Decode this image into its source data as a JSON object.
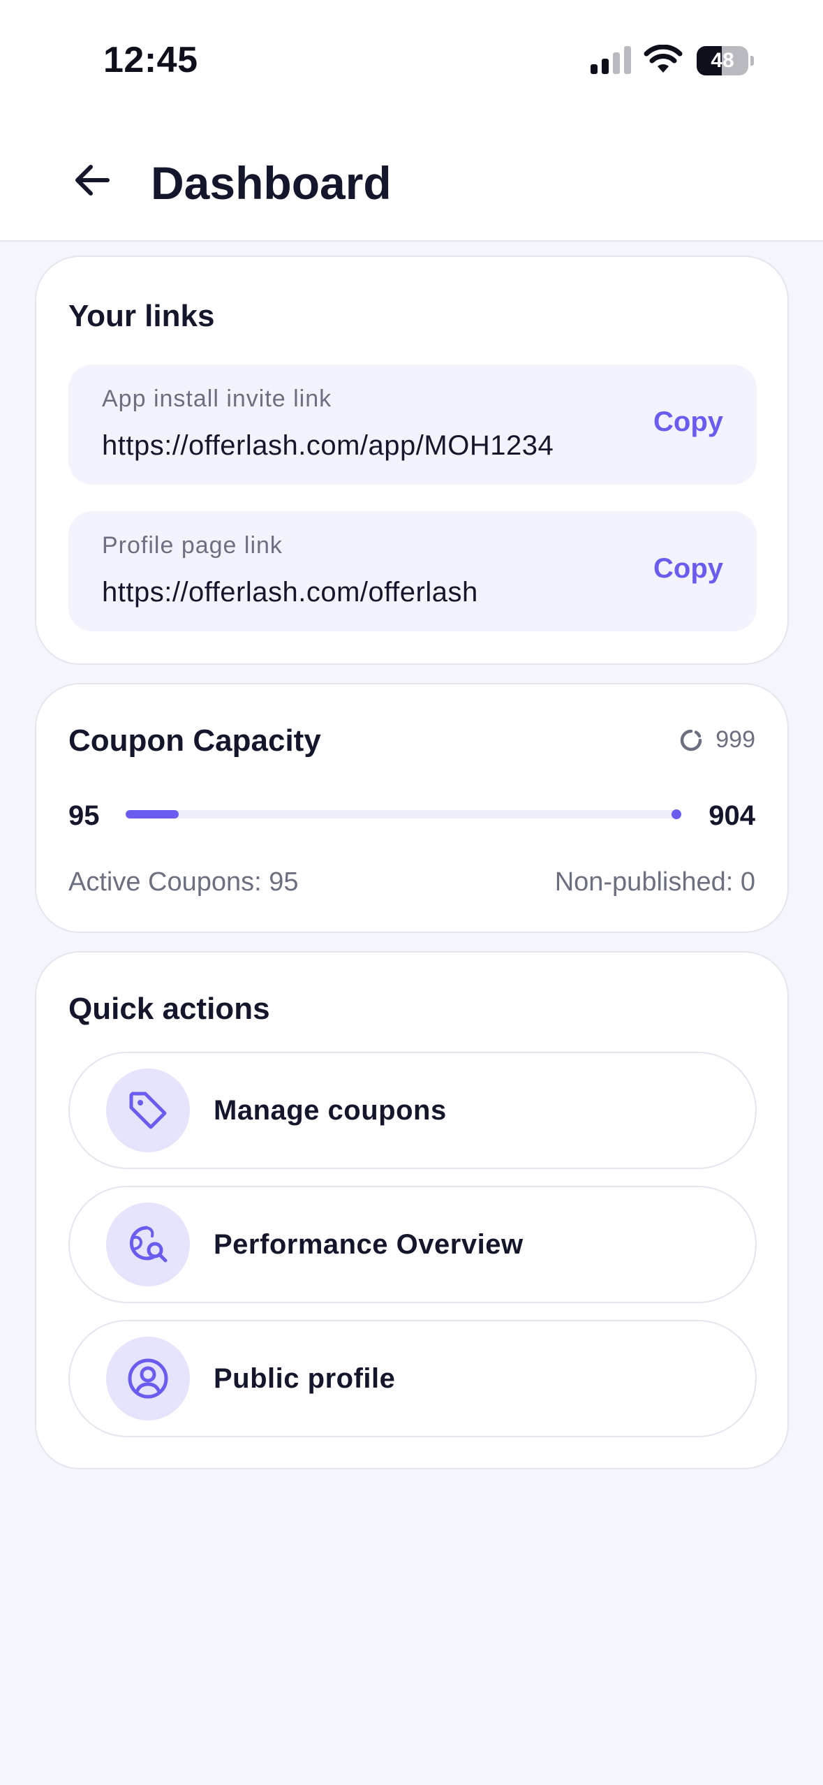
{
  "status_bar": {
    "time": "12:45",
    "battery_level": "48",
    "battery_fraction": 0.48
  },
  "header": {
    "title": "Dashboard",
    "back_icon": "arrow-left-icon"
  },
  "links": {
    "title": "Your links",
    "items": [
      {
        "label": "App install invite link",
        "url": "https://offerlash.com/app/MOH1234",
        "action": "Copy"
      },
      {
        "label": "Profile page link",
        "url": "https://offerlash.com/offerlash",
        "action": "Copy"
      }
    ]
  },
  "capacity": {
    "title": "Coupon Capacity",
    "total": "999",
    "total_icon": "loader-icon",
    "min_label": "95",
    "max_label": "904",
    "used": 95,
    "max": 999,
    "active_text": "Active Coupons: 95",
    "nonpublished_text": "Non-published: 0"
  },
  "quick_actions": {
    "title": "Quick actions",
    "items": [
      {
        "label": "Manage coupons",
        "icon": "tag-icon"
      },
      {
        "label": "Performance Overview",
        "icon": "globe-search-icon"
      },
      {
        "label": "Public profile",
        "icon": "user-circle-icon"
      }
    ]
  },
  "colors": {
    "accent": "#6b5cf0",
    "icon_bg": "#e6e4fd",
    "link_bg": "#f3f3fd",
    "page_bg": "#f5f6fb"
  }
}
